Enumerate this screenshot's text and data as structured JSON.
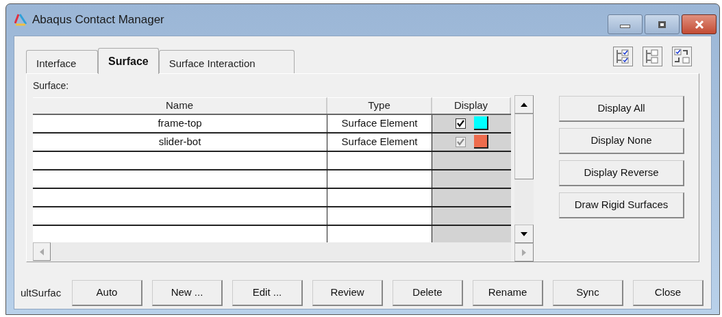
{
  "window": {
    "title": "Abaqus Contact Manager"
  },
  "tabs": [
    {
      "label": "Interface",
      "selected": false
    },
    {
      "label": "Surface",
      "selected": true
    },
    {
      "label": "Surface Interaction",
      "selected": false
    }
  ],
  "panel_label": "Surface:",
  "table": {
    "columns": [
      "Name",
      "Type",
      "Display"
    ],
    "rows": [
      {
        "name": "frame-top",
        "type": "Surface Element",
        "checked": true,
        "disabled": false,
        "color": "#00ffff"
      },
      {
        "name": "slider-bot",
        "type": "Surface Element",
        "checked": true,
        "disabled": true,
        "color": "#ee6c4d"
      }
    ]
  },
  "side_buttons": [
    "Display All",
    "Display None",
    "Display Reverse",
    "Draw Rigid Surfaces"
  ],
  "bottom_label": "ultSurfac",
  "bottom_buttons": [
    "Auto",
    "New ...",
    "Edit ...",
    "Review",
    "Delete",
    "Rename",
    "Sync",
    "Close"
  ]
}
